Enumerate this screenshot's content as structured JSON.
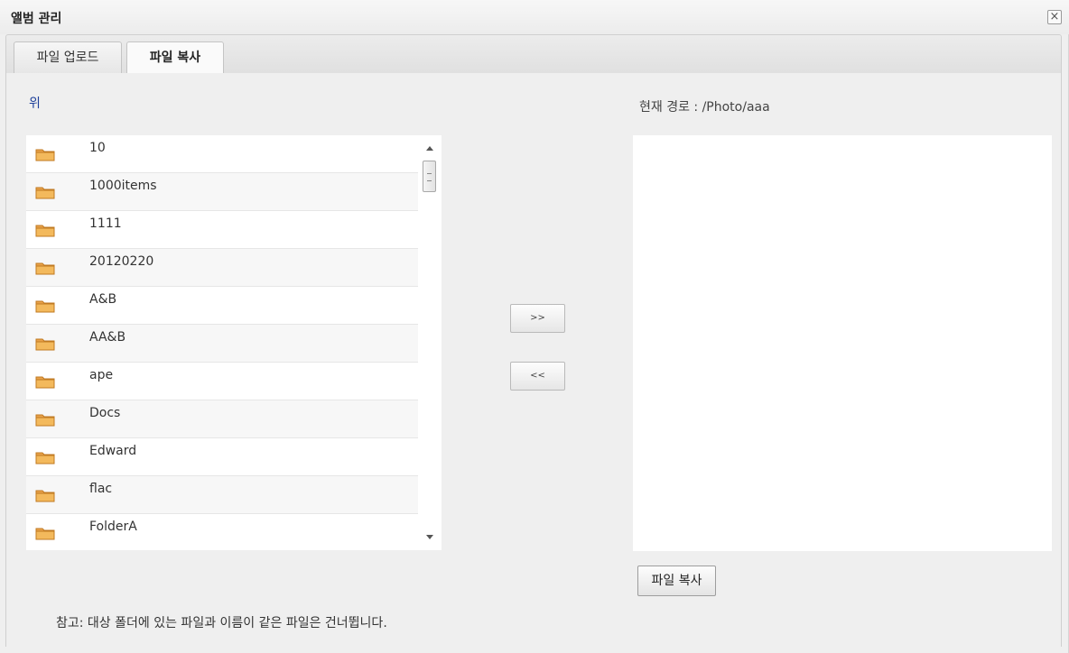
{
  "dialog": {
    "title": "앨범 관리",
    "close_glyph": "×"
  },
  "tabs": [
    {
      "label": "파일 업로드",
      "active": false
    },
    {
      "label": "파일 복사",
      "active": true
    }
  ],
  "source": {
    "up_link": "위",
    "folders": [
      {
        "name": "10",
        "icon": "folder-icon"
      },
      {
        "name": "1000items",
        "icon": "folder-icon"
      },
      {
        "name": "1111",
        "icon": "folder-icon"
      },
      {
        "name": "20120220",
        "icon": "folder-icon"
      },
      {
        "name": "A&B",
        "icon": "folder-icon"
      },
      {
        "name": "AA&B",
        "icon": "folder-icon"
      },
      {
        "name": "ape",
        "icon": "folder-icon"
      },
      {
        "name": "Docs",
        "icon": "folder-icon"
      },
      {
        "name": "Edward",
        "icon": "folder-icon"
      },
      {
        "name": "flac",
        "icon": "folder-icon"
      },
      {
        "name": "FolderA",
        "icon": "folder-icon"
      }
    ]
  },
  "actions": {
    "move_right": ">>",
    "move_left": "<<"
  },
  "destination": {
    "path_label": "현재 경로 : /Photo/aaa",
    "copy_button": "파일 복사"
  },
  "note": "참고: 대상 폴더에 있는 파일과 이름이 같은 파일은 건너뜁니다.",
  "colors": {
    "link": "#1d3f9a",
    "folder": "#e9a24a"
  }
}
